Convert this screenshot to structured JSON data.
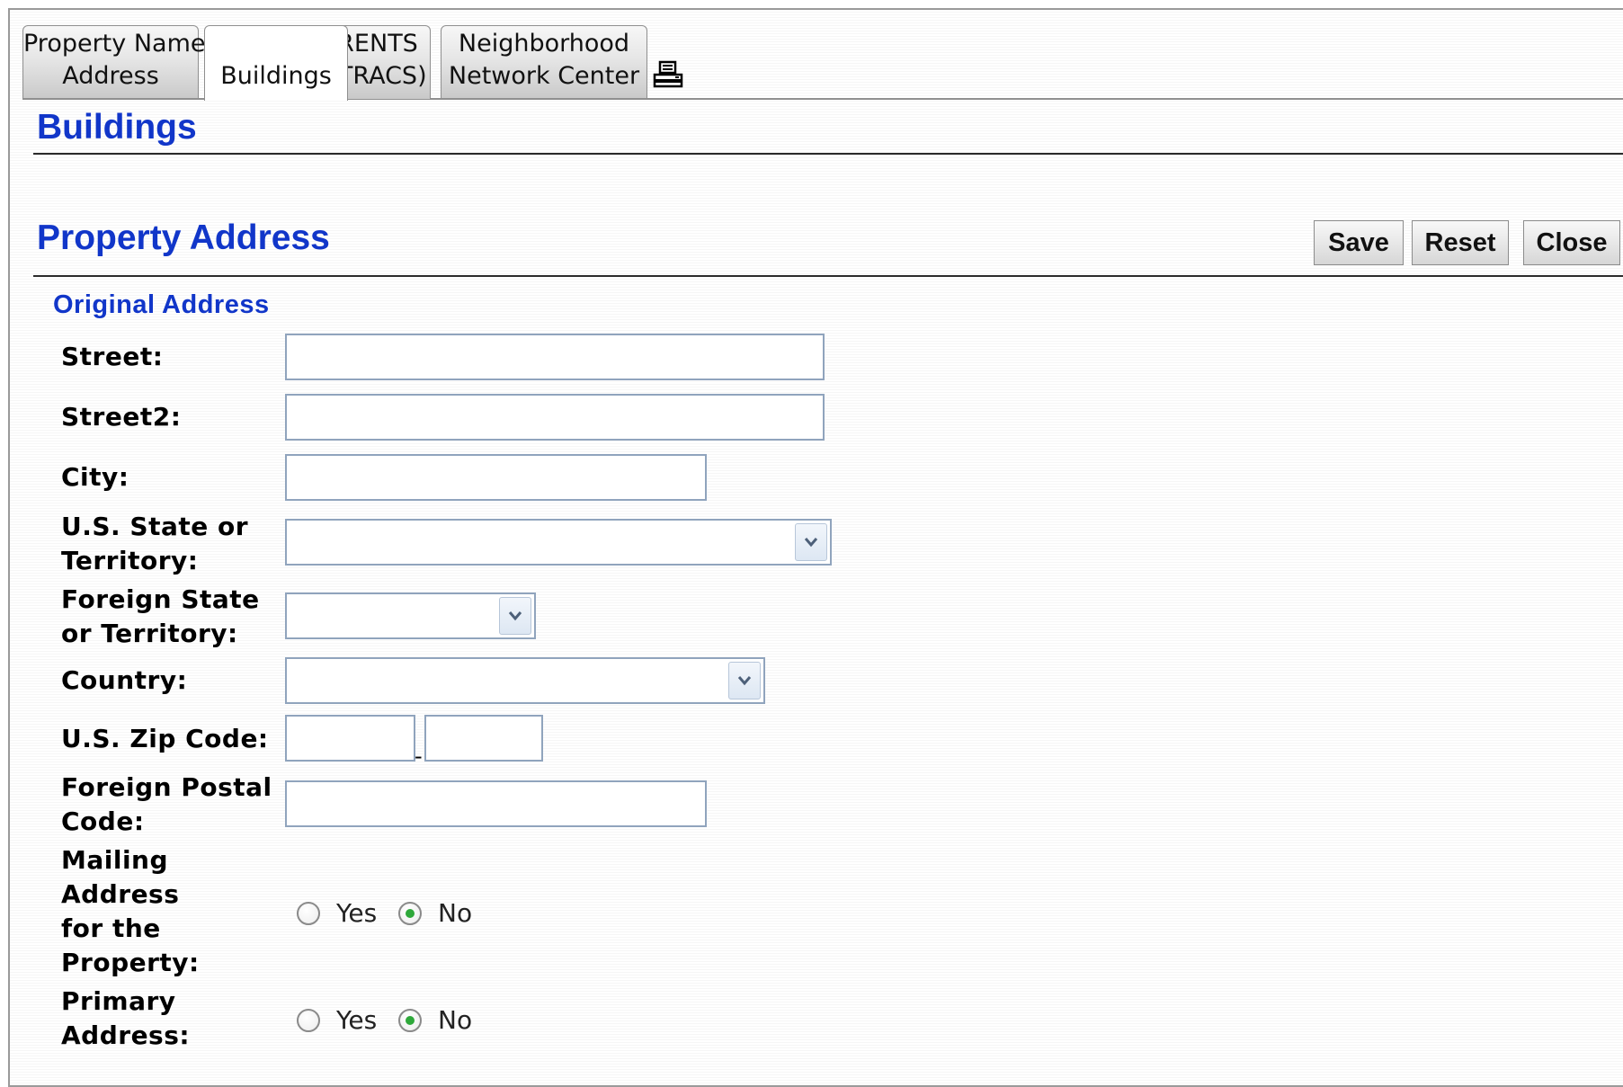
{
  "tabs": [
    {
      "label_line1": "Property Name,",
      "label_line2": "Address",
      "active": false
    },
    {
      "label_line1": "",
      "label_line2": "Buildings",
      "active": true
    },
    {
      "label_line1": "RENTS",
      "label_line2": "(TRACS)",
      "active": false
    },
    {
      "label_line1": "Neighborhood",
      "label_line2": "Network Center",
      "active": false
    }
  ],
  "print_icon": "printer-icon",
  "page_title": "Buildings",
  "section_title": "Property Address",
  "buttons": {
    "save": "Save",
    "reset": "Reset",
    "close": "Close"
  },
  "subsection_title": "Original Address",
  "form": {
    "street_label": "Street:",
    "street_value": "",
    "street2_label": "Street2:",
    "street2_value": "",
    "city_label": "City:",
    "city_value": "",
    "us_state_label_1": "U.S. State or",
    "us_state_label_2": "Territory:",
    "us_state_value": "",
    "foreign_state_label_1": "Foreign State",
    "foreign_state_label_2": "or Territory:",
    "foreign_state_value": "",
    "country_label": "Country:",
    "country_value": "",
    "zip_label": "U.S. Zip Code:",
    "zip_value": "",
    "zip_ext_value": "",
    "zip_separator": "-",
    "foreign_postal_label_1": "Foreign Postal",
    "foreign_postal_label_2": "Code:",
    "foreign_postal_value": "",
    "mailing_label_1": "Mailing",
    "mailing_label_2": "Address",
    "mailing_label_3": "for the",
    "mailing_label_4": "Property:",
    "mailing_selected": "No",
    "primary_label_1": "Primary",
    "primary_label_2": "Address:",
    "primary_selected": "No",
    "yes_label": "Yes",
    "no_label": "No"
  },
  "colors": {
    "heading_blue": "#1136c9",
    "input_border": "#90a4bd",
    "radio_checked": "#2ea83a"
  }
}
